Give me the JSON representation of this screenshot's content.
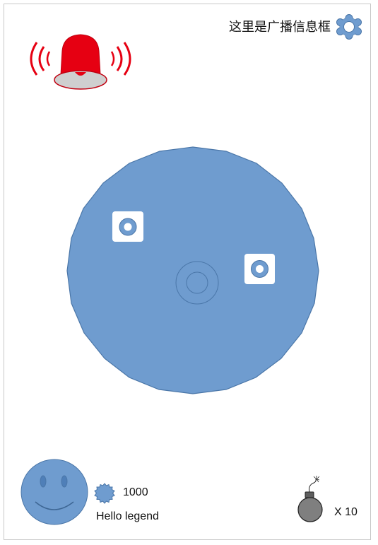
{
  "header": {
    "broadcast_text": "这里是广播信息框"
  },
  "player": {
    "coins": "1000",
    "greeting": "Hello legend"
  },
  "inventory": {
    "bomb_count": "X 10"
  },
  "colors": {
    "accent": "#6f9ccf",
    "accent_dark": "#4a76a8",
    "alarm_red": "#e60012",
    "bomb_gray": "#7f7f7f"
  },
  "icons": [
    "gear-icon",
    "alarm-bell-icon",
    "target-icon",
    "player-avatar",
    "coin-icon",
    "bomb-icon"
  ]
}
